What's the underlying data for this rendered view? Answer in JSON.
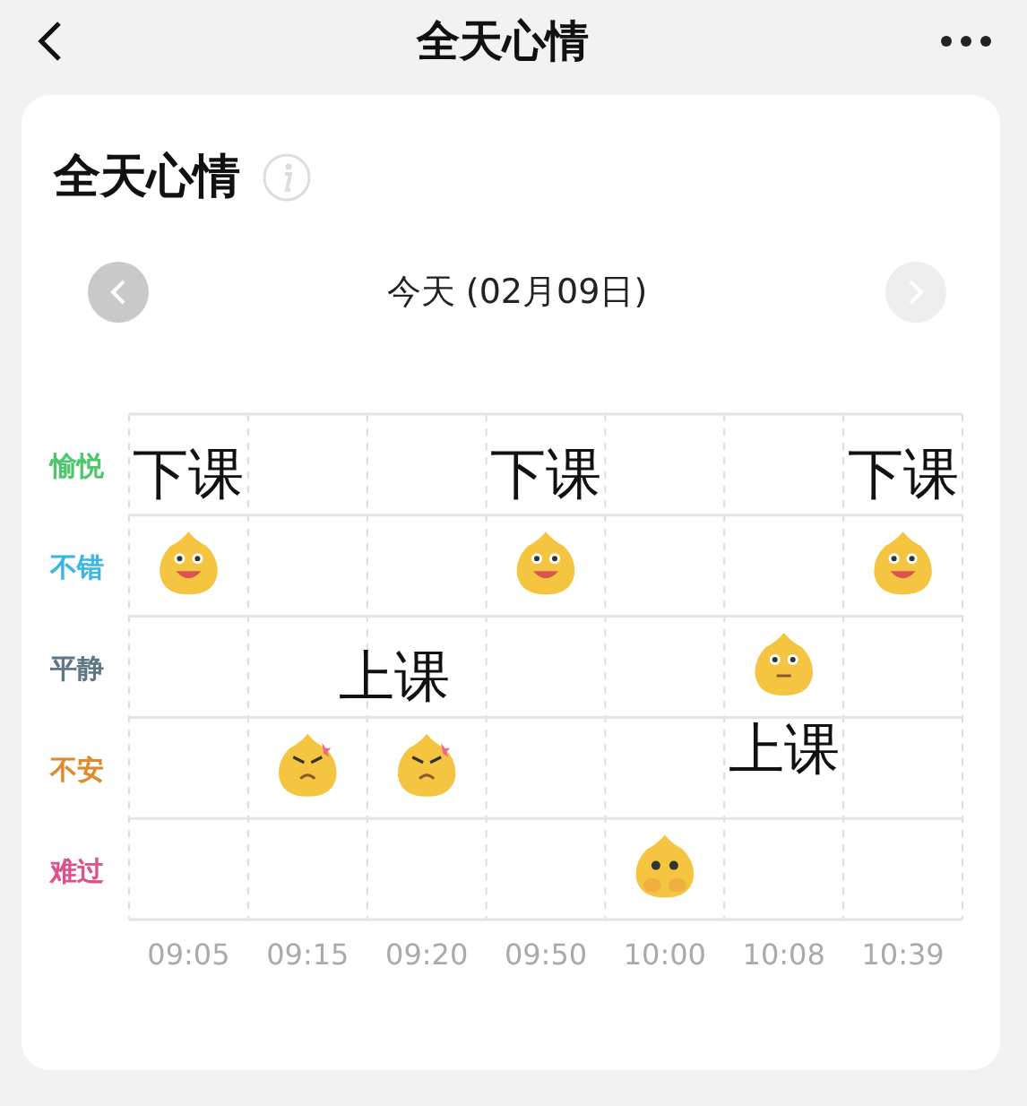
{
  "header": {
    "title": "全天心情"
  },
  "card": {
    "title": "全天心情",
    "date_nav": {
      "label": "今天 (02月09日)",
      "prev": {
        "disabled": false
      },
      "next": {
        "disabled": true
      }
    },
    "mood_grid": {
      "moods": [
        {
          "label": "愉悦",
          "color": "#4cc76a",
          "kind": "joyful"
        },
        {
          "label": "不错",
          "color": "#3cb4e6",
          "kind": "good"
        },
        {
          "label": "平静",
          "color": "#5f7684",
          "kind": "calm"
        },
        {
          "label": "不安",
          "color": "#e08a2a",
          "kind": "uneasy"
        },
        {
          "label": "难过",
          "color": "#e0508a",
          "kind": "sad"
        }
      ],
      "entries": [
        {
          "time": "09:05",
          "kind": "good",
          "note_above": "下课"
        },
        {
          "time": "09:15",
          "kind": "uneasy"
        },
        {
          "time": "09:20",
          "kind": "uneasy",
          "note_above": "上课"
        },
        {
          "time": "09:50",
          "kind": "good",
          "note_above": "下课"
        },
        {
          "time": "10:00",
          "kind": "sad"
        },
        {
          "time": "10:08",
          "kind": "calm",
          "note_below": "上课"
        },
        {
          "time": "10:39",
          "kind": "good",
          "note_above": "下课"
        }
      ]
    }
  }
}
